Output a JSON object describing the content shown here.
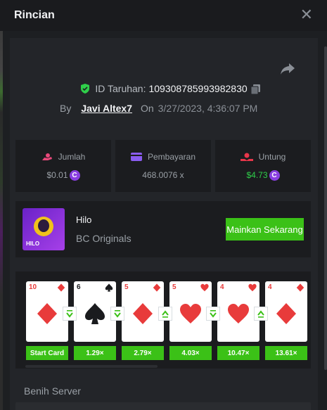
{
  "header": {
    "title": "Rincian",
    "close_icon": "close-icon"
  },
  "bet": {
    "id_label": "ID Taruhan:",
    "id_value": "109308785993982830",
    "by_label": "By",
    "user": "Javi Altex7",
    "on_label": "On",
    "date": "3/27/2023, 4:36:07 PM"
  },
  "stats": [
    {
      "label": "Jumlah",
      "value": "$0.01",
      "coin": true,
      "icon": "wager-icon",
      "color": "#e8487a"
    },
    {
      "label": "Pembayaran",
      "value": "468.0076 x",
      "coin": false,
      "icon": "payout-icon",
      "color": "#8a5cf0"
    },
    {
      "label": "Untung",
      "value": "$4.73",
      "coin": true,
      "icon": "profit-icon",
      "color": "#e8364a"
    }
  ],
  "coin_symbol": "C",
  "game": {
    "name": "Hilo",
    "provider": "BC Originals",
    "thumb_label": "HILO",
    "play_button": "Mainkan Sekarang"
  },
  "cards": [
    {
      "rank": "10",
      "suit": "diamond",
      "color": "#e83b3b",
      "mult": "Start Card"
    },
    {
      "rank": "6",
      "suit": "spade",
      "color": "#1a1b1e",
      "mult": "1.29×"
    },
    {
      "rank": "5",
      "suit": "diamond",
      "color": "#e83b3b",
      "mult": "2.79×"
    },
    {
      "rank": "5",
      "suit": "heart",
      "color": "#e83b3b",
      "mult": "4.03×"
    },
    {
      "rank": "4",
      "suit": "heart",
      "color": "#e83b3b",
      "mult": "10.47×"
    },
    {
      "rank": "4",
      "suit": "diamond",
      "color": "#e83b3b",
      "mult": "13.61×"
    }
  ],
  "arrows": [
    "down",
    "down",
    "up",
    "down",
    "up"
  ],
  "seed": {
    "label": "Benih Server"
  },
  "colors": {
    "accent_green": "#3bc117",
    "profit_green": "#2fcf4a",
    "coin_purple": "#8a3fe0",
    "shield_green": "#2fcf4a"
  }
}
